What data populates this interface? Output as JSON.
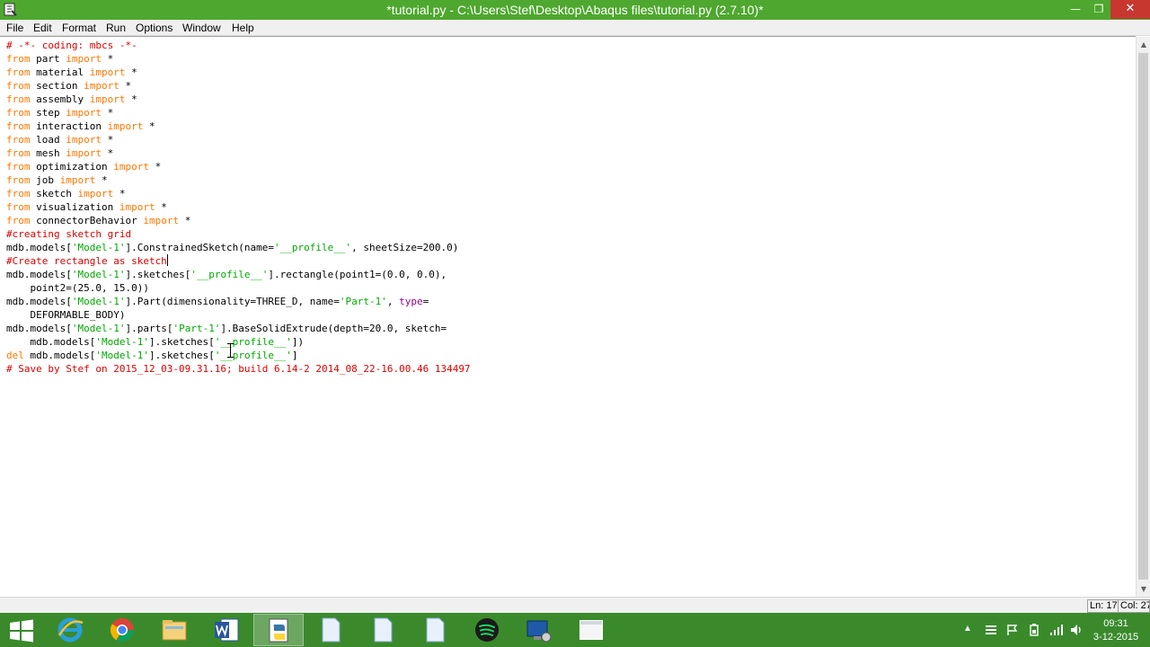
{
  "window": {
    "title": "*tutorial.py - C:\\Users\\Stef\\Desktop\\Abaqus files\\tutorial.py (2.7.10)*",
    "minimize_glyph": "—",
    "maximize_glyph": "❐",
    "close_glyph": "✕"
  },
  "menu": [
    "File",
    "Edit",
    "Format",
    "Run",
    "Options",
    "Window",
    "Help"
  ],
  "code_lines": [
    [
      {
        "t": "# -*- coding: mbcs -*-",
        "c": "com"
      }
    ],
    [
      {
        "t": "from",
        "c": "kw"
      },
      {
        "t": " part "
      },
      {
        "t": "import",
        "c": "kw"
      },
      {
        "t": " *"
      }
    ],
    [
      {
        "t": "from",
        "c": "kw"
      },
      {
        "t": " material "
      },
      {
        "t": "import",
        "c": "kw"
      },
      {
        "t": " *"
      }
    ],
    [
      {
        "t": "from",
        "c": "kw"
      },
      {
        "t": " section "
      },
      {
        "t": "import",
        "c": "kw"
      },
      {
        "t": " *"
      }
    ],
    [
      {
        "t": "from",
        "c": "kw"
      },
      {
        "t": " assembly "
      },
      {
        "t": "import",
        "c": "kw"
      },
      {
        "t": " *"
      }
    ],
    [
      {
        "t": "from",
        "c": "kw"
      },
      {
        "t": " step "
      },
      {
        "t": "import",
        "c": "kw"
      },
      {
        "t": " *"
      }
    ],
    [
      {
        "t": "from",
        "c": "kw"
      },
      {
        "t": " interaction "
      },
      {
        "t": "import",
        "c": "kw"
      },
      {
        "t": " *"
      }
    ],
    [
      {
        "t": "from",
        "c": "kw"
      },
      {
        "t": " load "
      },
      {
        "t": "import",
        "c": "kw"
      },
      {
        "t": " *"
      }
    ],
    [
      {
        "t": "from",
        "c": "kw"
      },
      {
        "t": " mesh "
      },
      {
        "t": "import",
        "c": "kw"
      },
      {
        "t": " *"
      }
    ],
    [
      {
        "t": "from",
        "c": "kw"
      },
      {
        "t": " optimization "
      },
      {
        "t": "import",
        "c": "kw"
      },
      {
        "t": " *"
      }
    ],
    [
      {
        "t": "from",
        "c": "kw"
      },
      {
        "t": " job "
      },
      {
        "t": "import",
        "c": "kw"
      },
      {
        "t": " *"
      }
    ],
    [
      {
        "t": "from",
        "c": "kw"
      },
      {
        "t": " sketch "
      },
      {
        "t": "import",
        "c": "kw"
      },
      {
        "t": " *"
      }
    ],
    [
      {
        "t": "from",
        "c": "kw"
      },
      {
        "t": " visualization "
      },
      {
        "t": "import",
        "c": "kw"
      },
      {
        "t": " *"
      }
    ],
    [
      {
        "t": "from",
        "c": "kw"
      },
      {
        "t": " connectorBehavior "
      },
      {
        "t": "import",
        "c": "kw"
      },
      {
        "t": " *"
      }
    ],
    [
      {
        "t": "#creating sketch grid",
        "c": "com"
      }
    ],
    [
      {
        "t": "mdb.models["
      },
      {
        "t": "'Model-1'",
        "c": "str"
      },
      {
        "t": "].ConstrainedSketch(name="
      },
      {
        "t": "'__profile__'",
        "c": "str"
      },
      {
        "t": ", sheetSize=200.0)"
      }
    ],
    [
      {
        "t": "#Create rectangle as sketch",
        "c": "com",
        "caret": true
      }
    ],
    [
      {
        "t": "mdb.models["
      },
      {
        "t": "'Model-1'",
        "c": "str"
      },
      {
        "t": "].sketches["
      },
      {
        "t": "'__profile__'",
        "c": "str"
      },
      {
        "t": "].rectangle(point1=(0.0, 0.0),"
      }
    ],
    [
      {
        "t": "    point2=(25.0, 15.0))"
      }
    ],
    [
      {
        "t": "mdb.models["
      },
      {
        "t": "'Model-1'",
        "c": "str"
      },
      {
        "t": "].Part(dimensionality=THREE_D, name="
      },
      {
        "t": "'Part-1'",
        "c": "str"
      },
      {
        "t": ", "
      },
      {
        "t": "type",
        "c": "builtin"
      },
      {
        "t": "="
      }
    ],
    [
      {
        "t": "    DEFORMABLE_BODY)"
      }
    ],
    [
      {
        "t": "mdb.models["
      },
      {
        "t": "'Model-1'",
        "c": "str"
      },
      {
        "t": "].parts["
      },
      {
        "t": "'Part-1'",
        "c": "str"
      },
      {
        "t": "].BaseSolidExtrude(depth=20.0, sketch="
      }
    ],
    [
      {
        "t": "    mdb.models["
      },
      {
        "t": "'Model-1'",
        "c": "str"
      },
      {
        "t": "].sketches["
      },
      {
        "t": "'__profile__'",
        "c": "str"
      },
      {
        "t": "])"
      }
    ],
    [
      {
        "t": "del",
        "c": "kw"
      },
      {
        "t": " mdb.models["
      },
      {
        "t": "'Model-1'",
        "c": "str"
      },
      {
        "t": "].sketches["
      },
      {
        "t": "'__profile__'",
        "c": "str"
      },
      {
        "t": "]"
      }
    ],
    [
      {
        "t": "# Save by Stef on 2015_12_03-09.31.16; build 6.14-2 2014_08_22-16.00.46 134497",
        "c": "com"
      }
    ]
  ],
  "status": {
    "line": "Ln: 17",
    "col": "Col: 27"
  },
  "taskbar": {
    "apps": [
      {
        "name": "start-button",
        "icon": "windows-logo-icon"
      },
      {
        "name": "internet-explorer",
        "icon": "ie-icon"
      },
      {
        "name": "chrome",
        "icon": "chrome-icon"
      },
      {
        "name": "file-explorer",
        "icon": "folder-icon"
      },
      {
        "name": "word",
        "icon": "word-icon"
      },
      {
        "name": "python-idle",
        "icon": "python-icon",
        "active": true
      },
      {
        "name": "document-1",
        "icon": "document-icon"
      },
      {
        "name": "document-2",
        "icon": "document-icon"
      },
      {
        "name": "document-3",
        "icon": "document-icon"
      },
      {
        "name": "spotify",
        "icon": "spotify-icon"
      },
      {
        "name": "abaqus",
        "icon": "abaqus-icon"
      },
      {
        "name": "misc-app",
        "icon": "window-icon"
      }
    ],
    "clock": {
      "time": "09:31",
      "date": "3-12-2015"
    }
  },
  "colors": {
    "titlebar": "#4ea72e",
    "taskbar": "#3a8a2c",
    "keyword": "#ff7700",
    "string": "#00aa00",
    "comment": "#dd0000",
    "builtin": "#900090"
  }
}
